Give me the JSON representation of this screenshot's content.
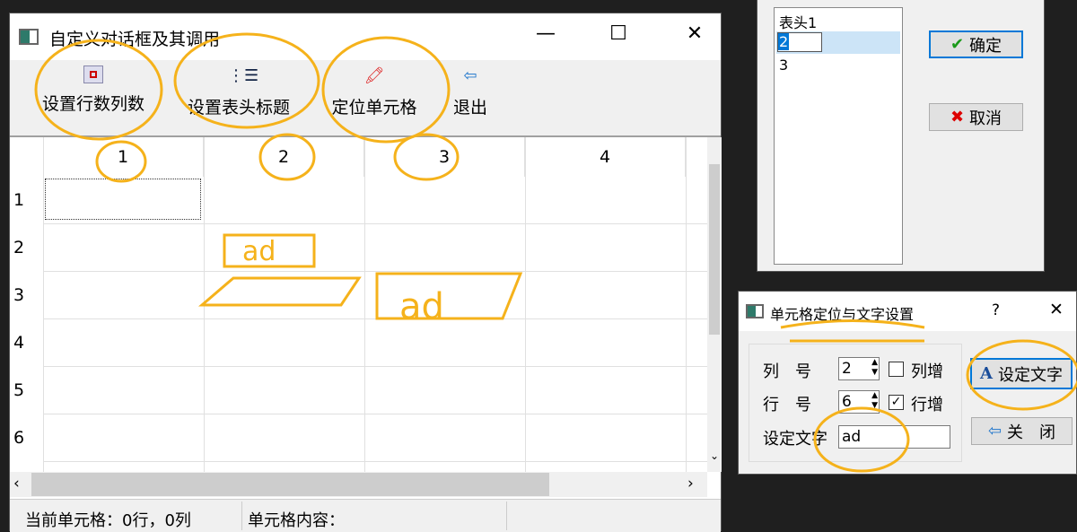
{
  "main": {
    "title": "自定义对话框及其调用",
    "toolbar": [
      {
        "label": "设置行数列数",
        "icon": "grid-icon"
      },
      {
        "label": "设置表头标题",
        "icon": "list-icon"
      },
      {
        "label": "定位单元格",
        "icon": "locate-icon"
      },
      {
        "label": "退出",
        "icon": "exit-icon"
      }
    ],
    "columns": [
      "1",
      "2",
      "3",
      "4"
    ],
    "rows": [
      "1",
      "2",
      "3",
      "4",
      "5",
      "6"
    ],
    "status": {
      "current_cell": "当前单元格：0行，0列",
      "cell_content": "单元格内容："
    }
  },
  "header_dialog": {
    "items": [
      "表头1",
      "2",
      "3"
    ],
    "editing_value": "2",
    "ok": "确定",
    "cancel": "取消"
  },
  "locate_dialog": {
    "title": "单元格定位与文字设置",
    "help": "?",
    "col_label": "列　号",
    "col_value": "2",
    "col_inc": "列增",
    "col_inc_checked": false,
    "row_label": "行　号",
    "row_value": "6",
    "row_inc": "行增",
    "row_inc_checked": true,
    "text_label": "设定文字",
    "text_value": "ad",
    "set_text": "设定文字",
    "close": "关　闭"
  },
  "annotations": {
    "handwritten_text": "ad",
    "accent": "#f5b21b"
  }
}
